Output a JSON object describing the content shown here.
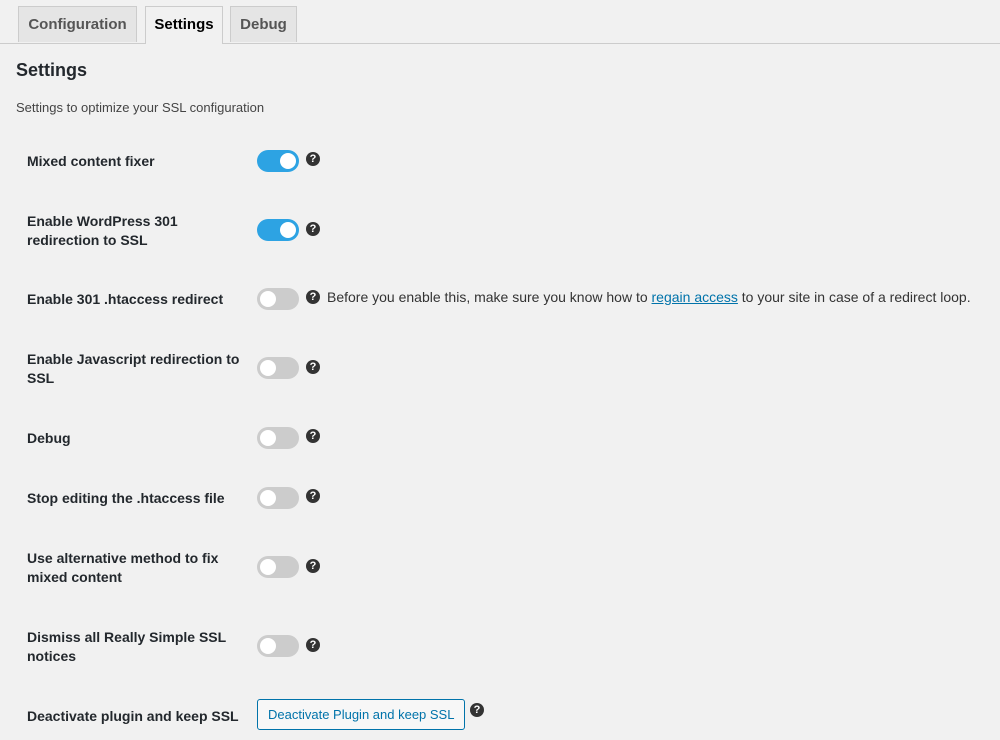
{
  "tabs": [
    {
      "label": "Configuration",
      "active": false
    },
    {
      "label": "Settings",
      "active": true
    },
    {
      "label": "Debug",
      "active": false
    }
  ],
  "section": {
    "title": "Settings",
    "description": "Settings to optimize your SSL configuration"
  },
  "settings": [
    {
      "label": "Mixed content fixer",
      "enabled": true
    },
    {
      "label": "Enable WordPress 301 redirection to SSL",
      "enabled": true
    },
    {
      "label": "Enable 301 .htaccess redirect",
      "enabled": false,
      "note_before": "Before you enable this, make sure you know how to ",
      "note_link": "regain access",
      "note_after": " to your site in case of a redirect loop."
    },
    {
      "label": "Enable Javascript redirection to SSL",
      "enabled": false
    },
    {
      "label": "Debug",
      "enabled": false
    },
    {
      "label": "Stop editing the .htaccess file",
      "enabled": false
    },
    {
      "label": "Use alternative method to fix mixed content",
      "enabled": false
    },
    {
      "label": "Dismiss all Really Simple SSL notices",
      "enabled": false
    }
  ],
  "deactivate": {
    "label": "Deactivate plugin and keep SSL",
    "button_label": "Deactivate Plugin and keep SSL"
  },
  "help_glyph": "?",
  "colors": {
    "toggle_on": "#2da3e3",
    "toggle_off": "#cccccc",
    "link": "#0073aa"
  }
}
